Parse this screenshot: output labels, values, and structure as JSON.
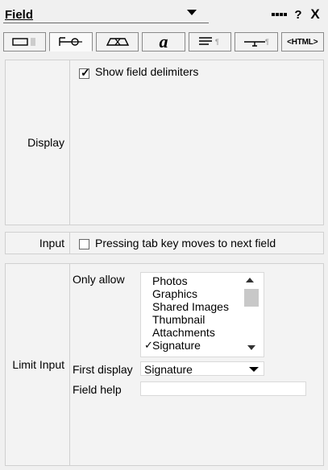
{
  "header": {
    "title": "Field",
    "help_label": "?",
    "close_label": "X"
  },
  "tabs": [
    {
      "name": "Display options",
      "icon": "field-frame-icon"
    },
    {
      "name": "Input",
      "icon": "tab-key-icon"
    },
    {
      "name": "Shape",
      "icon": "shape-icon"
    },
    {
      "name": "Font",
      "icon": "font-a-icon",
      "text": "a"
    },
    {
      "name": "Paragraph",
      "icon": "paragraph-lines-icon"
    },
    {
      "name": "Tabs",
      "icon": "tab-stop-icon"
    },
    {
      "name": "HTML",
      "icon": "html-icon",
      "text": "HTML"
    }
  ],
  "display": {
    "label": "Display",
    "show_field_delimiters": {
      "label": "Show field delimiters",
      "checked": true
    }
  },
  "input": {
    "label": "Input",
    "pressing_tab": {
      "label": "Pressing tab key moves to next field",
      "checked": false
    }
  },
  "limit_input": {
    "label": "Limit Input",
    "only_allow_label": "Only allow",
    "options": [
      "Photos",
      "Graphics",
      "Shared Images",
      "Thumbnail",
      "Attachments",
      "Signature"
    ],
    "checked_option": "Signature",
    "first_display_label": "First display",
    "first_display_value": "Signature",
    "field_help_label": "Field help",
    "field_help_value": ""
  }
}
